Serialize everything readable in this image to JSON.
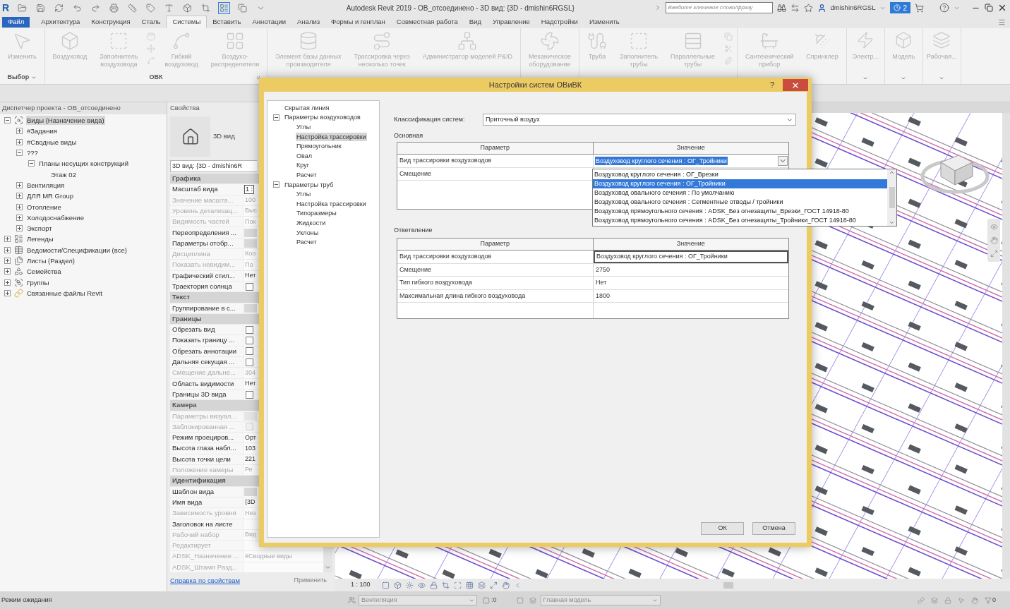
{
  "title_bar": {
    "logo": "R",
    "quick_access": [
      {
        "kind": "open",
        "active": false
      },
      {
        "kind": "save",
        "active": false
      },
      {
        "kind": "sync",
        "active": false
      },
      {
        "kind": "undo",
        "active": false
      },
      {
        "kind": "redo",
        "active": false
      },
      {
        "kind": "print",
        "active": false
      },
      {
        "kind": "measure",
        "active": false
      },
      {
        "kind": "tag",
        "active": false
      },
      {
        "kind": "text",
        "active": false
      },
      {
        "kind": "view3d",
        "active": false
      },
      {
        "kind": "section",
        "active": false
      },
      {
        "kind": "thinlines",
        "active": true
      },
      {
        "kind": "windows",
        "active": false
      },
      {
        "kind": "more",
        "active": false
      }
    ],
    "title": "Autodesk Revit 2019 - ОВ_отсоединено - 3D вид: {3D - dmishin6RGSL}",
    "search_placeholder": "Введите ключевое слово/фразу",
    "user": "dmishin6RGSL",
    "notifications": "2"
  },
  "ribbon_tabs": [
    {
      "label": "Файл",
      "kind": "application",
      "selected": false
    },
    {
      "label": "Архитектура",
      "kind": "tab",
      "selected": false
    },
    {
      "label": "Конструкция",
      "kind": "tab",
      "selected": false
    },
    {
      "label": "Сталь",
      "kind": "tab",
      "selected": false
    },
    {
      "label": "Системы",
      "kind": "tab",
      "selected": true
    },
    {
      "label": "Вставить",
      "kind": "tab",
      "selected": false
    },
    {
      "label": "Аннотации",
      "kind": "tab",
      "selected": false
    },
    {
      "label": "Анализ",
      "kind": "tab",
      "selected": false
    },
    {
      "label": "Формы и генплан",
      "kind": "tab",
      "selected": false
    },
    {
      "label": "Совместная работа",
      "kind": "tab",
      "selected": false
    },
    {
      "label": "Вид",
      "kind": "tab",
      "selected": false
    },
    {
      "label": "Управление",
      "kind": "tab",
      "selected": false
    },
    {
      "label": "Надстройки",
      "kind": "tab",
      "selected": false
    },
    {
      "label": "Изменить",
      "kind": "tab",
      "selected": false
    }
  ],
  "ribbon": {
    "panels": [
      {
        "kind": "group",
        "label": "Выбор",
        "menu": true,
        "launcher": false,
        "buttons": [
          {
            "kind": "large",
            "label": "Изменить",
            "disabled": true
          }
        ]
      },
      {
        "kind": "group",
        "label": "ОВК",
        "menu": false,
        "launcher": true,
        "buttons": [
          {
            "kind": "large",
            "label": "Воздуховод",
            "disabled": true
          },
          {
            "kind": "large",
            "label": "Заполнитель\nвоздуховода",
            "disabled": true
          },
          {
            "kind": "stack",
            "disabled": true
          },
          {
            "kind": "large",
            "label": "Гибкий\nвоздуховод",
            "disabled": true
          },
          {
            "kind": "large",
            "label": "Воздухо-\nраспределители",
            "disabled": true
          }
        ]
      },
      {
        "kind": "group",
        "buttons": [
          {
            "kind": "large",
            "label": "Элемент базы данных\nпроизводителя",
            "disabled": true
          },
          {
            "kind": "large",
            "label": "Трассировка через\nнесколько точек",
            "disabled": true
          },
          {
            "kind": "large",
            "label": "Администратор моделей P&ID",
            "disabled": true
          }
        ]
      },
      {
        "kind": "group",
        "buttons": [
          {
            "kind": "large",
            "label": "Механическое\nоборудование",
            "disabled": true
          }
        ]
      },
      {
        "kind": "group",
        "buttons": [
          {
            "kind": "large",
            "label": "Труба",
            "disabled": true
          },
          {
            "kind": "large",
            "label": "Заполнитель\nтрубы",
            "disabled": true
          },
          {
            "kind": "large",
            "label": "Параллельные\nтрубы",
            "disabled": true
          },
          {
            "kind": "stack",
            "disabled": true
          }
        ]
      },
      {
        "kind": "group",
        "buttons": [
          {
            "kind": "large",
            "label": "Сантехнический\nприбор",
            "disabled": true
          },
          {
            "kind": "large",
            "label": "Спринклер",
            "disabled": true
          }
        ]
      },
      {
        "kind": "collapsed",
        "label": "Электр...",
        "disabled": true
      },
      {
        "kind": "collapsed",
        "label": "Модель",
        "disabled": true
      },
      {
        "kind": "collapsed",
        "label": "Рабочая...",
        "disabled": true
      }
    ]
  },
  "project_browser": {
    "title": "Диспетчер проекта - ОВ_отсоединено",
    "tree": [
      {
        "label": "Виды (Назначение вида)",
        "kind": "views",
        "expanded": true,
        "selected": true,
        "children": [
          {
            "label": "#Задания",
            "expanded": false,
            "selected": false
          },
          {
            "label": "#Сводные виды",
            "expanded": false,
            "selected": false
          },
          {
            "label": "???",
            "expanded": true,
            "selected": false,
            "children": [
              {
                "label": "Планы несущих конструкций",
                "expanded": true,
                "selected": false,
                "children": [
                  {
                    "label": "Этаж 02",
                    "selected": false
                  }
                ]
              }
            ]
          },
          {
            "label": "Вентиляция",
            "expanded": false,
            "selected": false
          },
          {
            "label": "ДЛЯ MR Group",
            "expanded": false,
            "selected": false
          },
          {
            "label": "Отопление",
            "expanded": false,
            "selected": false
          },
          {
            "label": "Холодоснабжение",
            "expanded": false,
            "selected": false
          },
          {
            "label": "Экспорт",
            "expanded": false,
            "selected": false
          }
        ]
      },
      {
        "label": "Легенды",
        "kind": "legends",
        "expanded": false,
        "selected": false
      },
      {
        "label": "Ведомости/Спецификации (все)",
        "kind": "schedules",
        "expanded": false,
        "selected": false
      },
      {
        "label": "Листы (Раздел)",
        "kind": "sheets",
        "expanded": false,
        "selected": false
      },
      {
        "label": "Семейства",
        "kind": "families",
        "expanded": false,
        "selected": false
      },
      {
        "label": "Группы",
        "kind": "groups",
        "expanded": false,
        "selected": false
      },
      {
        "label": "Связанные файлы Revit",
        "kind": "links",
        "expanded": false,
        "selected": false
      }
    ]
  },
  "properties": {
    "title": "Свойства",
    "type_name": "3D вид",
    "instance_selector": "3D вид: {3D - dmishin6R",
    "groups": [
      {
        "name": "Графика",
        "rows": [
          {
            "label": "Масштаб вида",
            "kind": "field",
            "value": "1 :",
            "disabled": false
          },
          {
            "label": "Значение масшта...",
            "kind": "text",
            "value": "100",
            "disabled": true
          },
          {
            "label": "Уровень детализац...",
            "kind": "text",
            "value": "Выс",
            "disabled": true
          },
          {
            "label": "Видимость частей",
            "kind": "text",
            "value": "Пок",
            "disabled": true
          },
          {
            "label": "Переопределения ...",
            "kind": "button",
            "disabled": false
          },
          {
            "label": "Параметры отобр...",
            "kind": "button",
            "disabled": false
          },
          {
            "label": "Дисциплина",
            "kind": "text",
            "value": "Коо",
            "disabled": true
          },
          {
            "label": "Показать невидим...",
            "kind": "text",
            "value": "По",
            "disabled": true
          },
          {
            "label": "Графический стил...",
            "kind": "text",
            "value": "Нет",
            "disabled": false
          },
          {
            "label": "Траектория солнца",
            "kind": "checkbox",
            "checked": false,
            "disabled": false
          }
        ]
      },
      {
        "name": "Текст",
        "rows": [
          {
            "label": "Группирование в с...",
            "kind": "button",
            "disabled": false
          }
        ]
      },
      {
        "name": "Границы",
        "rows": [
          {
            "label": "Обрезать вид",
            "kind": "checkbox",
            "checked": false,
            "disabled": false
          },
          {
            "label": "Показать границу ...",
            "kind": "checkbox",
            "checked": false,
            "disabled": false
          },
          {
            "label": "Обрезать аннотации",
            "kind": "checkbox",
            "checked": false,
            "disabled": false
          },
          {
            "label": "Дальняя секущая ...",
            "kind": "checkbox",
            "checked": false,
            "disabled": false
          },
          {
            "label": "Смещение дальне...",
            "kind": "text",
            "value": "304",
            "disabled": true
          },
          {
            "label": "Область видимости",
            "kind": "text",
            "value": "Нет",
            "disabled": false
          },
          {
            "label": "Границы 3D вида",
            "kind": "checkbox",
            "checked": false,
            "disabled": false
          }
        ]
      },
      {
        "name": "Камера",
        "rows": [
          {
            "label": "Параметры визуал...",
            "kind": "button",
            "disabled": true
          },
          {
            "label": "Заблокированная ...",
            "kind": "checkbox",
            "checked": false,
            "disabled": true
          },
          {
            "label": "Режим проециров...",
            "kind": "text",
            "value": "Орт",
            "disabled": false
          },
          {
            "label": "Высота глаза набл...",
            "kind": "text",
            "value": "103",
            "disabled": false
          },
          {
            "label": "Высота точки цели",
            "kind": "text",
            "value": "221",
            "disabled": false
          },
          {
            "label": "Положение камеры",
            "kind": "text",
            "value": "Ре",
            "disabled": true
          }
        ]
      },
      {
        "name": "Идентификация",
        "rows": [
          {
            "label": "Шаблон вида",
            "kind": "button",
            "disabled": false
          },
          {
            "label": "Имя вида",
            "kind": "text",
            "value": "{3D",
            "disabled": false
          },
          {
            "label": "Зависимость уровня",
            "kind": "text",
            "value": "Нез",
            "disabled": true
          },
          {
            "label": "Заголовок на листе",
            "kind": "empty",
            "disabled": false
          },
          {
            "label": "Рабочий набор",
            "kind": "text",
            "value": "Вид",
            "disabled": true
          },
          {
            "label": "Редактирует",
            "kind": "empty",
            "disabled": true
          },
          {
            "label": "ADSK_Назначение ...",
            "kind": "text",
            "value": "#Сводные виды",
            "disabled": true
          },
          {
            "label": "ADSK_Штамп Разд...",
            "kind": "empty",
            "disabled": true
          }
        ]
      }
    ],
    "help_link": "Справка по свойствам",
    "apply_button": {
      "label": "Применить",
      "disabled": true
    }
  },
  "view": {
    "scale": "1 : 100"
  },
  "status_bar": {
    "message": "Режим ожидания",
    "workset": "Вентиляция",
    "indicator_count": ":0",
    "design_option": "Главная модель",
    "filter_count": "0"
  },
  "dialog": {
    "title": "Настройки систем ОВиВК",
    "help": "?",
    "tree": [
      {
        "label": "Скрытая линия",
        "selected": false
      },
      {
        "label": "Параметры воздуховодов",
        "expanded": true,
        "selected": false,
        "children": [
          {
            "label": "Углы",
            "selected": false
          },
          {
            "label": "Настройка трассировки",
            "selected": true
          },
          {
            "label": "Прямоугольник",
            "selected": false
          },
          {
            "label": "Овал",
            "selected": false
          },
          {
            "label": "Круг",
            "selected": false
          },
          {
            "label": "Расчет",
            "selected": false
          }
        ]
      },
      {
        "label": "Параметры труб",
        "expanded": true,
        "selected": false,
        "children": [
          {
            "label": "Углы",
            "selected": false
          },
          {
            "label": "Настройка трассировки",
            "selected": false
          },
          {
            "label": "Типоразмеры",
            "selected": false
          },
          {
            "label": "Жидкости",
            "selected": false
          },
          {
            "label": "Уклоны",
            "selected": false
          },
          {
            "label": "Расчет",
            "selected": false
          }
        ]
      }
    ],
    "classification": {
      "label": "Классификация систем:",
      "value": "Приточный воздух"
    },
    "sections": [
      {
        "title": "Основная",
        "columns": [
          "Параметр",
          "Значение"
        ],
        "rows": [
          {
            "parameter": "Вид трассировки воздуховодов",
            "kind": "combo",
            "value": "Воздуховод круглого сечения : ОГ_Тройники",
            "open": true,
            "options": [
              {
                "label": "Воздуховод круглого сечения : ОГ_Врезки",
                "selected": false
              },
              {
                "label": "Воздуховод круглого сечения : ОГ_Тройники",
                "selected": true
              },
              {
                "label": "Воздуховод овального сечения : По умолчанию",
                "selected": false
              },
              {
                "label": "Воздуховод овального сечения : Сегментные отводы / тройники",
                "selected": false
              },
              {
                "label": "Воздуховод прямоугольного сечения : ADSK_Без огнезащиты_Врезки_ГОСТ 14918-80",
                "selected": false
              },
              {
                "label": "Воздуховод прямоугольного сечения : ADSK_Без огнезащиты_Тройники_ГОСТ 14918-80",
                "selected": false
              }
            ]
          },
          {
            "parameter": "Смещение",
            "kind": "text"
          }
        ]
      },
      {
        "title": "Ответвление",
        "columns": [
          "Параметр",
          "Значение"
        ],
        "rows": [
          {
            "parameter": "Вид трассировки воздуховодов",
            "kind": "boxed",
            "value": "Воздуховод круглого сечения : ОГ_Тройники"
          },
          {
            "parameter": "Смещение",
            "kind": "text",
            "value": "2750"
          },
          {
            "parameter": "Тип гибкого воздуховода",
            "kind": "text",
            "value": "Нет"
          },
          {
            "parameter": "Максимальная длина гибкого воздуховода",
            "kind": "text",
            "value": "1800"
          }
        ]
      }
    ],
    "buttons": [
      "ОК",
      "Отмена"
    ]
  }
}
